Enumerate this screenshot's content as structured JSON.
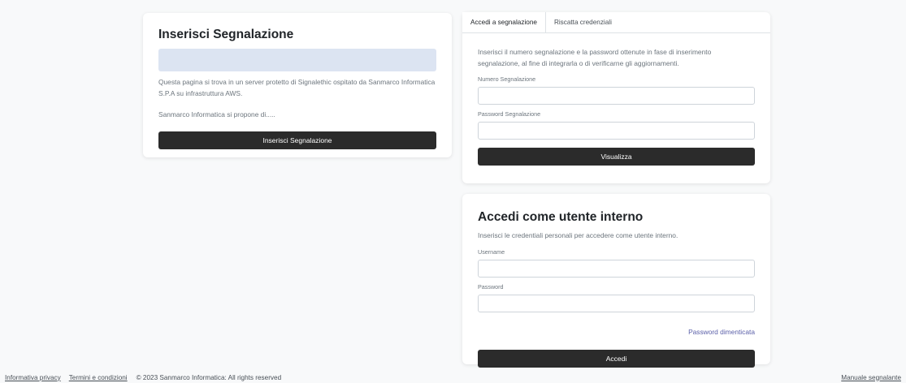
{
  "left_card": {
    "title": "Inserisci Segnalazione",
    "description": "Questa pagina si trova in un server protetto di Signalethic ospitato da Sanmarco Informatica S.P.A su infrastruttura AWS.",
    "proposal": "Sanmarco Informatica si propone di.....",
    "button_label": "Inserisci Segnalazione"
  },
  "access_card": {
    "tabs": [
      {
        "label": "Accedi a segnalazione"
      },
      {
        "label": "Riscatta credenziali"
      }
    ],
    "description": "Inserisci il numero segnalazione e la password ottenute in fase di inserimento segnalazione, al fine di integrarla o di verificarne gli aggiornamenti.",
    "number_label": "Numero Segnalazione",
    "password_label": "Password Segnalazione",
    "button_label": "Visualizza"
  },
  "internal_card": {
    "title": "Accedi come utente interno",
    "description": "Inserisci le credentiali personali per accedere come utente interno.",
    "username_label": "Username",
    "password_label": "Password",
    "forgot_label": "Password dimenticata",
    "button_label": "Accedi"
  },
  "footer": {
    "privacy": "Informativa privacy",
    "terms": "Termini e condizioni",
    "copyright": "© 2023 Sanmarco Informatica: All rights reserved",
    "manual": "Manuale segnalante"
  }
}
